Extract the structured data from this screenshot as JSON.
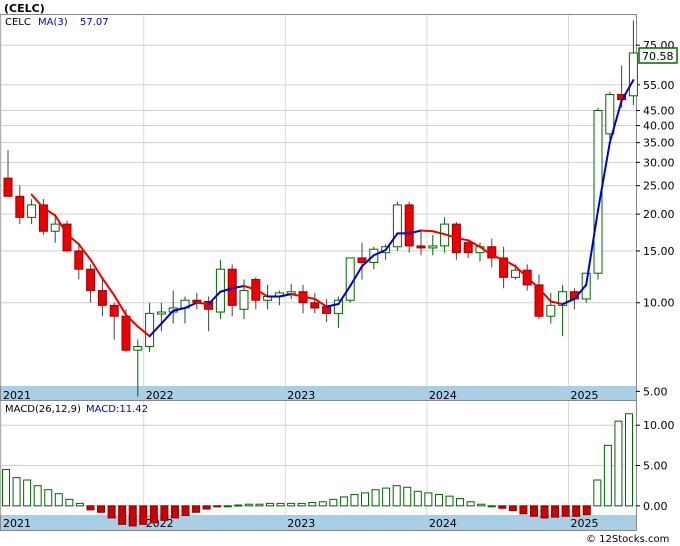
{
  "chart_data": [
    {
      "type": "candlestick",
      "ticker_title": "(CELC)",
      "legend": {
        "series_name": "CELC",
        "ma_label": "MA(3)",
        "ma_value": "57.07"
      },
      "last_price": "70.58",
      "y_ticks": [
        "75.00",
        "55.00",
        "45.00",
        "40.00",
        "35.00",
        "30.00",
        "25.00",
        "20.00",
        "15.00",
        "10.00",
        "5.00"
      ],
      "y_tick_values": [
        75,
        55,
        45,
        40,
        35,
        30,
        25,
        20,
        15,
        10,
        5
      ],
      "y_scale": "log",
      "ylim": [
        4.6,
        95
      ],
      "x_ticks": [
        "2021",
        "2022",
        "2023",
        "2024",
        "2025"
      ],
      "x_tick_months": [
        0,
        12,
        24,
        36,
        48
      ],
      "candles": [
        {
          "m": 0,
          "o": 26.5,
          "h": 33,
          "l": 23,
          "c": 23
        },
        {
          "m": 1,
          "o": 23,
          "h": 25,
          "l": 18.5,
          "c": 19.5
        },
        {
          "m": 2,
          "o": 19.5,
          "h": 22.5,
          "l": 18.5,
          "c": 21.5
        },
        {
          "m": 3,
          "o": 21.5,
          "h": 22.5,
          "l": 17,
          "c": 17.5
        },
        {
          "m": 4,
          "o": 17.5,
          "h": 20,
          "l": 16,
          "c": 18.5
        },
        {
          "m": 5,
          "o": 18.5,
          "h": 19,
          "l": 15,
          "c": 15
        },
        {
          "m": 6,
          "o": 15,
          "h": 16,
          "l": 12,
          "c": 13
        },
        {
          "m": 7,
          "o": 13,
          "h": 13.5,
          "l": 10,
          "c": 11
        },
        {
          "m": 8,
          "o": 11,
          "h": 12,
          "l": 9,
          "c": 9.8
        },
        {
          "m": 9,
          "o": 9.8,
          "h": 10,
          "l": 7.5,
          "c": 9
        },
        {
          "m": 10,
          "o": 9,
          "h": 9.5,
          "l": 6.8,
          "c": 6.9
        },
        {
          "m": 11,
          "o": 6.9,
          "h": 7.5,
          "l": 4.8,
          "c": 7.1
        },
        {
          "m": 12,
          "o": 7.1,
          "h": 10,
          "l": 6.8,
          "c": 9.2
        },
        {
          "m": 13,
          "o": 9.2,
          "h": 10,
          "l": 8,
          "c": 9.3
        },
        {
          "m": 14,
          "o": 9.3,
          "h": 11,
          "l": 8.5,
          "c": 9.6
        },
        {
          "m": 15,
          "o": 9.6,
          "h": 10.5,
          "l": 8.5,
          "c": 10.2
        },
        {
          "m": 16,
          "o": 10.2,
          "h": 10.8,
          "l": 9.5,
          "c": 10.1
        },
        {
          "m": 17,
          "o": 10.1,
          "h": 10.5,
          "l": 8,
          "c": 9.5
        },
        {
          "m": 18,
          "o": 9.3,
          "h": 14,
          "l": 8.8,
          "c": 13
        },
        {
          "m": 19,
          "o": 13,
          "h": 13.5,
          "l": 9,
          "c": 9.8
        },
        {
          "m": 20,
          "o": 9.5,
          "h": 12,
          "l": 8.8,
          "c": 11
        },
        {
          "m": 21,
          "o": 12,
          "h": 12.2,
          "l": 9.5,
          "c": 10.2
        },
        {
          "m": 22,
          "o": 10.2,
          "h": 11.5,
          "l": 9.5,
          "c": 10.5
        },
        {
          "m": 23,
          "o": 10.5,
          "h": 11,
          "l": 9.8,
          "c": 10.8
        },
        {
          "m": 24,
          "o": 10.8,
          "h": 11.6,
          "l": 10.3,
          "c": 10.9
        },
        {
          "m": 25,
          "o": 10.9,
          "h": 11.5,
          "l": 9.2,
          "c": 10
        },
        {
          "m": 26,
          "o": 10,
          "h": 10.8,
          "l": 9.2,
          "c": 9.6
        },
        {
          "m": 27,
          "o": 9.7,
          "h": 10.3,
          "l": 8.6,
          "c": 9.2
        },
        {
          "m": 28,
          "o": 9.2,
          "h": 10.5,
          "l": 8.2,
          "c": 10.2
        },
        {
          "m": 29,
          "o": 10.2,
          "h": 14.2,
          "l": 10,
          "c": 14.2
        },
        {
          "m": 30,
          "o": 14.2,
          "h": 16,
          "l": 12,
          "c": 13.7
        },
        {
          "m": 31,
          "o": 13.7,
          "h": 15.5,
          "l": 13,
          "c": 15.2
        },
        {
          "m": 32,
          "o": 14.8,
          "h": 15.8,
          "l": 14,
          "c": 15.5
        },
        {
          "m": 33,
          "o": 15.5,
          "h": 22,
          "l": 15,
          "c": 21.5
        },
        {
          "m": 34,
          "o": 21.5,
          "h": 22,
          "l": 14.8,
          "c": 15.6
        },
        {
          "m": 35,
          "o": 15.6,
          "h": 17.5,
          "l": 14.5,
          "c": 15.5
        },
        {
          "m": 36,
          "o": 15.5,
          "h": 17,
          "l": 14.5,
          "c": 15.6
        },
        {
          "m": 37,
          "o": 15.6,
          "h": 19.5,
          "l": 14.8,
          "c": 18.5
        },
        {
          "m": 38,
          "o": 18.5,
          "h": 18.8,
          "l": 14,
          "c": 14.8
        },
        {
          "m": 39,
          "o": 16,
          "h": 16.3,
          "l": 14.2,
          "c": 14.8
        },
        {
          "m": 40,
          "o": 14.8,
          "h": 16,
          "l": 13.8,
          "c": 15.5
        },
        {
          "m": 41,
          "o": 15.5,
          "h": 16.5,
          "l": 13.2,
          "c": 14.2
        },
        {
          "m": 42,
          "o": 14.2,
          "h": 15.5,
          "l": 11.2,
          "c": 12.2
        },
        {
          "m": 43,
          "o": 12.2,
          "h": 13.5,
          "l": 12,
          "c": 12.9
        },
        {
          "m": 44,
          "o": 12.9,
          "h": 13.5,
          "l": 11,
          "c": 11.5
        },
        {
          "m": 45,
          "o": 11.5,
          "h": 12.5,
          "l": 8.8,
          "c": 9
        },
        {
          "m": 46,
          "o": 9,
          "h": 10.8,
          "l": 8.5,
          "c": 9.8
        },
        {
          "m": 47,
          "o": 9.8,
          "h": 11.5,
          "l": 7.7,
          "c": 10.9
        },
        {
          "m": 48,
          "o": 10.9,
          "h": 11.2,
          "l": 9.5,
          "c": 10.3
        },
        {
          "m": 49,
          "o": 10.3,
          "h": 12.5,
          "l": 10,
          "c": 12.6
        },
        {
          "m": 50,
          "o": 12.6,
          "h": 46,
          "l": 12,
          "c": 45
        },
        {
          "m": 51,
          "o": 37.5,
          "h": 52,
          "l": 36,
          "c": 51
        },
        {
          "m": 52,
          "o": 51,
          "h": 64,
          "l": 46,
          "c": 49
        },
        {
          "m": 53,
          "o": 50.5,
          "h": 91,
          "l": 47,
          "c": 70.58
        }
      ],
      "ma3": [
        null,
        null,
        23.3,
        21,
        19.8,
        17.1,
        15.8,
        14,
        12.1,
        10.6,
        9.1,
        8.3,
        7.7,
        8.5,
        9.4,
        9.6,
        10,
        9.9,
        10.9,
        11.2,
        11.4,
        11.1,
        10.5,
        10.5,
        10.7,
        10.5,
        10.3,
        9.7,
        9.9,
        11.4,
        13.3,
        14.5,
        15.1,
        17.2,
        17.2,
        17.6,
        17.5,
        17.1,
        16.6,
        16.3,
        15.5,
        14.5,
        14,
        13.3,
        12.2,
        11.2,
        10.1,
        9.9,
        10.3,
        11.5,
        20.6,
        35,
        48.6,
        57.07
      ],
      "ma_up_color": "#0000cc",
      "ma_down_color": "#ee0000",
      "candle_up_fill": "#ffffff",
      "candle_up_border": "#006600",
      "candle_down_fill": "#ee0000"
    },
    {
      "type": "bar",
      "indicator_label": "MACD(26,12,9)",
      "value_label": "MACD:11.42",
      "y_ticks": [
        "10.00",
        "5.00",
        "0.00"
      ],
      "y_tick_values": [
        10,
        5,
        0
      ],
      "ylim": [
        -3,
        13
      ],
      "x_ticks": [
        "2021",
        "2022",
        "2023",
        "2024",
        "2025"
      ],
      "histogram": [
        4.5,
        3.5,
        3.2,
        2.5,
        2.0,
        1.5,
        0.8,
        0.3,
        -0.5,
        -0.8,
        -1.5,
        -2.3,
        -2.5,
        -2.3,
        -2.1,
        -1.8,
        -1.5,
        -1.2,
        -0.8,
        -0.4,
        -0.1,
        0,
        0.1,
        0.2,
        0.2,
        0.3,
        0.3,
        0.3,
        0.3,
        0.4,
        0.5,
        0.8,
        1.1,
        1.4,
        1.6,
        2.0,
        2.2,
        2.5,
        2.3,
        1.8,
        1.6,
        1.4,
        1.2,
        0.9,
        0.5,
        0.2,
        0,
        -0.3,
        -0.6,
        -1.0,
        -1.3,
        -1.5,
        -1.4,
        -1.3,
        -1.3,
        -1.1,
        3.2,
        7.5,
        10.5,
        11.42
      ],
      "pos_color": "#006600",
      "neg_color": "#cc0000"
    }
  ],
  "watermark": "© 12Stocks.com",
  "ui": {
    "axis_bar_color": "#a9cfe6",
    "price_box_border": "#006600"
  }
}
